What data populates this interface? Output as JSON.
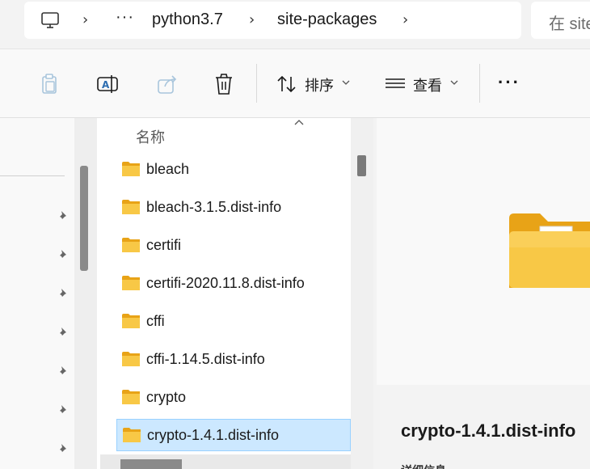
{
  "address_bar": {
    "location_icon": "computer-monitor-icon",
    "overflow": "···",
    "crumbs": [
      "python3.7",
      "site-packages"
    ]
  },
  "search": {
    "placeholder": "在 site"
  },
  "toolbar": {
    "copy_icon": "clipboard-icon",
    "rename_icon": "rename-icon",
    "share_icon": "share-icon",
    "delete_icon": "trash-icon",
    "sort_label": "排序",
    "view_label": "查看",
    "more_label": "···"
  },
  "file_list": {
    "column_header": "名称",
    "items": [
      {
        "name": "bleach",
        "selected": false
      },
      {
        "name": "bleach-3.1.5.dist-info",
        "selected": false
      },
      {
        "name": "certifi",
        "selected": false
      },
      {
        "name": "certifi-2020.11.8.dist-info",
        "selected": false
      },
      {
        "name": "cffi",
        "selected": false
      },
      {
        "name": "cffi-1.14.5.dist-info",
        "selected": false
      },
      {
        "name": "crypto",
        "selected": false
      },
      {
        "name": "crypto-1.4.1.dist-info",
        "selected": true
      }
    ]
  },
  "details": {
    "title": "crypto-1.4.1.dist-info",
    "section_label": "详细信息"
  },
  "colors": {
    "folder_yellow": "#f8c846",
    "selection": "#cce8ff",
    "selection_border": "#99d1ff"
  }
}
